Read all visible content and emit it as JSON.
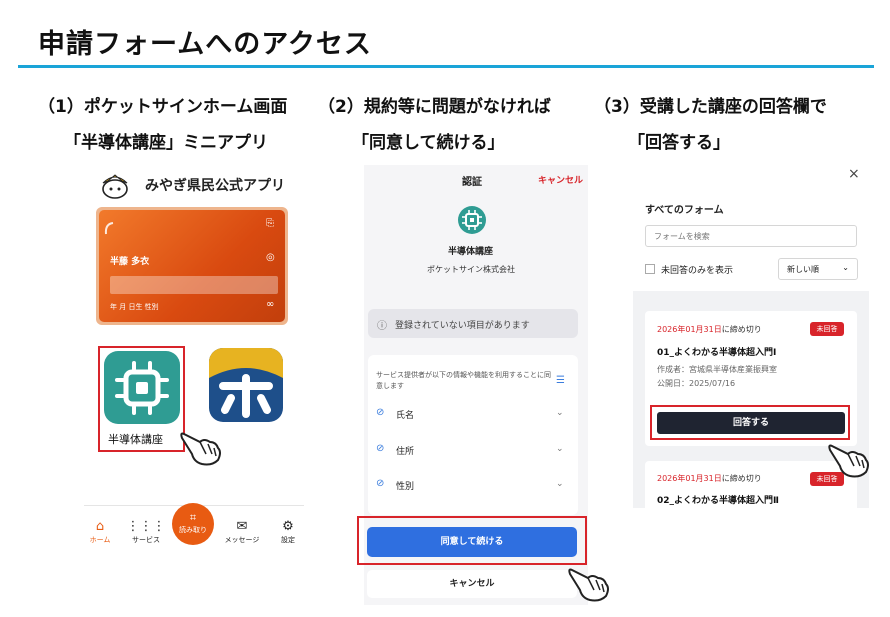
{
  "header": {
    "title": "申請フォームへのアクセス"
  },
  "steps": [
    {
      "line1": "（1）ポケットサインホーム画面",
      "line2": "「半導体講座」ミニアプリ"
    },
    {
      "line1": "（2）規約等に問題がなければ",
      "line2": "「同意して続ける」"
    },
    {
      "line1": "（3）受講した講座の回答欄で",
      "line2": "「回答する」"
    }
  ],
  "panel1": {
    "app_title": "みやぎ県民公式アプリ",
    "card": {
      "name": "半藤 多衣",
      "dob_label": "年 月 日生 性別"
    },
    "mini_app_label": "半導体講座",
    "nav": {
      "home": "ホーム",
      "service": "サービス",
      "scan": "読み取り",
      "message": "メッセージ",
      "settings": "設定"
    },
    "colors": {
      "accent": "#e85b12",
      "mini_app": "#2f9c93"
    }
  },
  "panel2": {
    "header_title": "認証",
    "cancel_link": "キャンセル",
    "service_name": "半導体講座",
    "company": "ポケットサイン株式会社",
    "warning": "登録されていない項目があります",
    "consent_text": "サービス提供者が以下の情報や機能を利用することに同意します",
    "items": [
      "氏名",
      "住所",
      "性別"
    ],
    "agree_button": "同意して続ける",
    "cancel_button": "キャンセル",
    "colors": {
      "primary": "#2f6fe0",
      "highlight": "#d8242a"
    }
  },
  "panel3": {
    "close": "×",
    "title": "すべてのフォーム",
    "search_placeholder": "フォームを検索",
    "unanswered_only": "未回答のみを表示",
    "sort": "新しい順",
    "forms": [
      {
        "deadline_date": "2026年01月31日",
        "deadline_suffix": "に締め切り",
        "badge": "未回答",
        "name": "01_よくわかる半導体超入門Ⅰ",
        "author": "作成者：宮城県半導体産業振興室",
        "published": "公開日：2025/07/16",
        "answer_button": "回答する"
      },
      {
        "deadline_date": "2026年01月31日",
        "deadline_suffix": "に締め切り",
        "badge": "未回答",
        "name": "02_よくわかる半導体超入門Ⅱ"
      }
    ]
  }
}
